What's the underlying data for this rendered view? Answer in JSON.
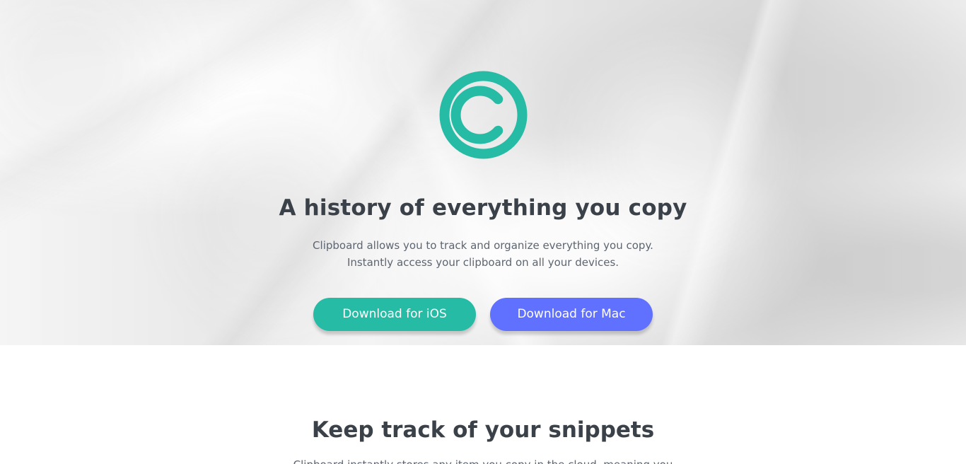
{
  "hero": {
    "title": "A history of everything you copy",
    "description": [
      "Clipboard allows you to track and organize everything you copy.",
      "Instantly access your clipboard on all your devices."
    ],
    "buttons": {
      "ios": "Download for iOS",
      "mac": "Download for Mac"
    },
    "logo_icon": "copyright-icon",
    "logo_color": "#26bba4"
  },
  "section": {
    "title": "Keep track of your snippets",
    "description_preview": "Clipboard instantly stores any item you copy in the cloud, meaning you"
  },
  "colors": {
    "primary_teal": "#26bba4",
    "accent_blue": "#6070ff",
    "text_dark": "#3a4149",
    "text_muted": "#5d6570"
  }
}
